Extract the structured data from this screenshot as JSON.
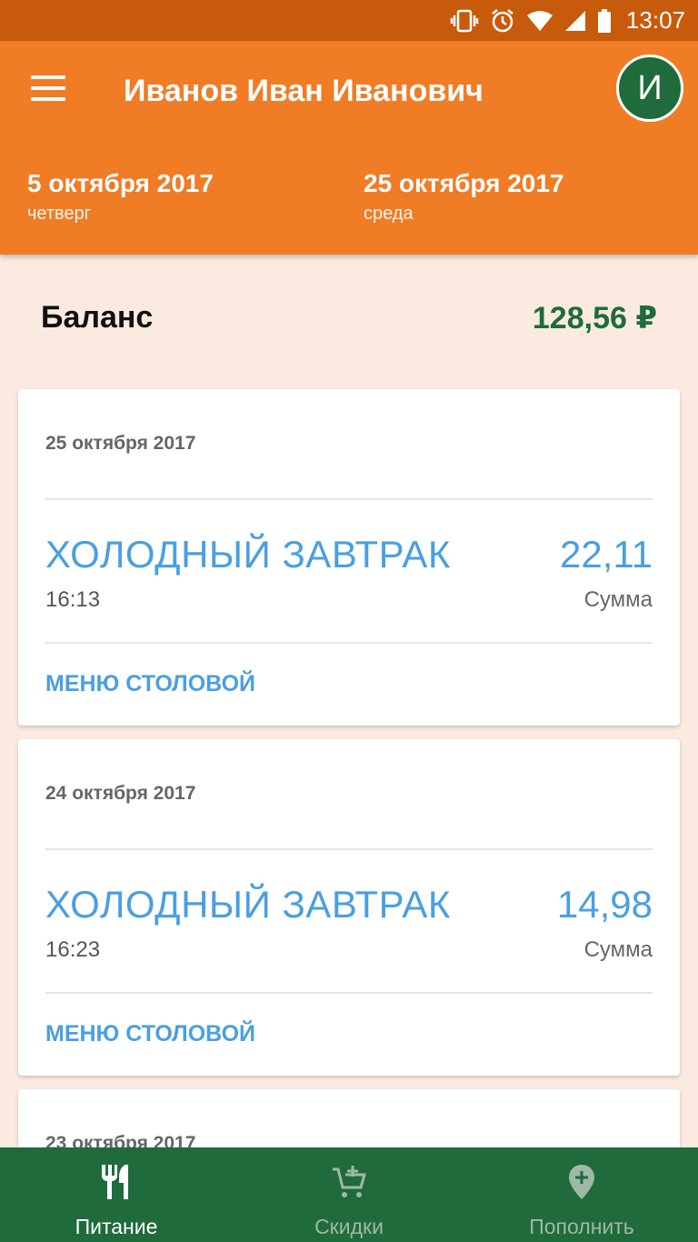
{
  "status_bar": {
    "time": "13:07"
  },
  "header": {
    "user_name": "Иванов Иван Иванович",
    "avatar_letter": "И",
    "date_start": {
      "date": "5 октября 2017",
      "weekday": "четверг"
    },
    "date_end": {
      "date": "25 октября 2017",
      "weekday": "среда"
    }
  },
  "balance": {
    "label": "Баланс",
    "value": "128,56 ₽"
  },
  "cards": [
    {
      "date": "25 октября 2017",
      "meal": "ХОЛОДНЫЙ ЗАВТРАК",
      "time": "16:13",
      "amount": "22,11",
      "amount_label": "Сумма",
      "link": "МЕНЮ СТОЛОВОЙ"
    },
    {
      "date": "24 октября 2017",
      "meal": "ХОЛОДНЫЙ ЗАВТРАК",
      "time": "16:23",
      "amount": "14,98",
      "amount_label": "Сумма",
      "link": "МЕНЮ СТОЛОВОЙ"
    },
    {
      "date": "23 октября 2017"
    }
  ],
  "bottom_nav": [
    {
      "label": "Питание",
      "icon": "cutlery-icon",
      "active": true
    },
    {
      "label": "Скидки",
      "icon": "cart-add-icon",
      "active": false
    },
    {
      "label": "Пополнить",
      "icon": "location-add-icon",
      "active": false
    }
  ],
  "colors": {
    "status_bar": "#C85A0B",
    "app_bar": "#F07C26",
    "background": "#FBEAE0",
    "primary_green": "#1F6B3B",
    "accent_blue": "#4A9FE0"
  }
}
